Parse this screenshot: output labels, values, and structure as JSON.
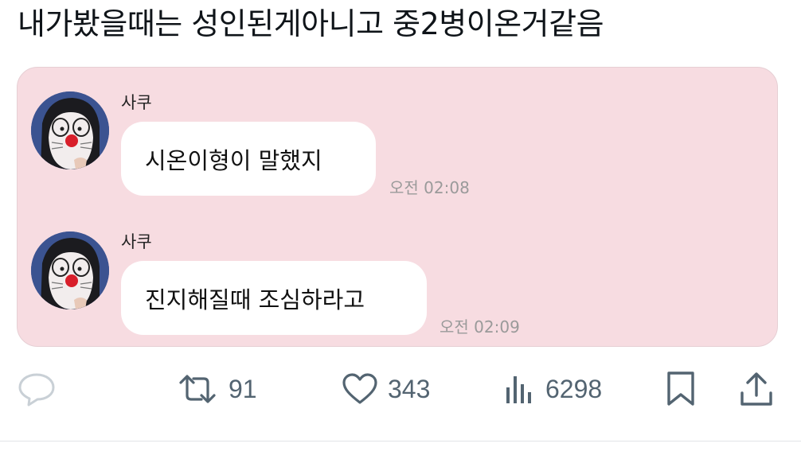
{
  "tweet": {
    "text": "내가봤을때는 성인된게아니고 중2병이온거같음"
  },
  "chat": {
    "messages": [
      {
        "sender": "사쿠",
        "text": "시온이형이 말했지",
        "time": "오전 02:08"
      },
      {
        "sender": "사쿠",
        "text": "진지해질때 조심하라고",
        "time": "오전 02:09"
      }
    ]
  },
  "actions": {
    "reply": {
      "icon": "reply-icon"
    },
    "retweet": {
      "icon": "retweet-icon",
      "count": "91"
    },
    "like": {
      "icon": "heart-icon",
      "count": "343"
    },
    "views": {
      "icon": "views-chart-icon",
      "count": "6298"
    },
    "bookmark": {
      "icon": "bookmark-icon"
    },
    "share": {
      "icon": "share-icon"
    }
  },
  "colors": {
    "card_background": "#f7dce1",
    "bubble_background": "#ffffff",
    "icon_gray": "#536471",
    "reply_icon_light": "#c9d0d6"
  }
}
